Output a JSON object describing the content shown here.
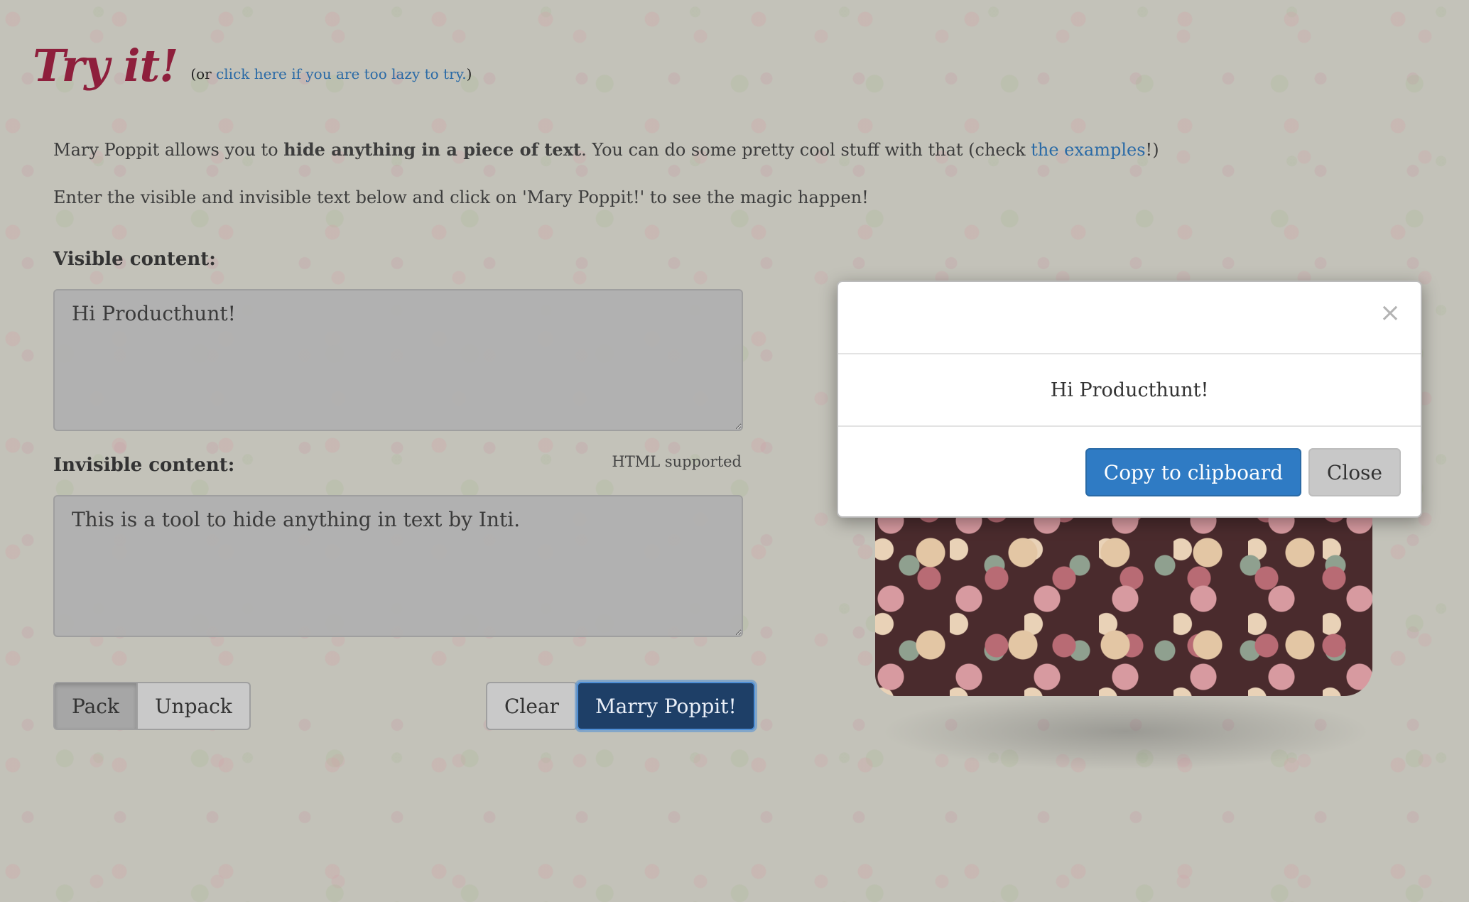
{
  "header": {
    "title": "Try it!",
    "lazy_prefix": "(or ",
    "lazy_link": "click here if you are too lazy to try.",
    "lazy_suffix": ")"
  },
  "intro": {
    "line1_a": "Mary Poppit allows you to ",
    "line1_bold": "hide anything in a piece of text",
    "line1_b": ". You can do some pretty cool stuff with that (check ",
    "line1_link": "the examples",
    "line1_c": "!)",
    "line2": "Enter the visible and invisible text below and click on 'Mary Poppit!' to see the magic happen!"
  },
  "form": {
    "visible_label": "Visible content:",
    "visible_value": "Hi Producthunt!",
    "invisible_label": "Invisible content:",
    "invisible_hint": "HTML supported",
    "invisible_value": "This is a tool to hide anything in text by Inti.",
    "pack_label": "Pack",
    "unpack_label": "Unpack",
    "clear_label": "Clear",
    "marry_label": "Marry Poppit!"
  },
  "modal": {
    "close_symbol": "×",
    "body_text": "Hi Producthunt!",
    "copy_label": "Copy to clipboard",
    "close_label": "Close"
  },
  "colors": {
    "title": "#8e1f3c",
    "link": "#2a6aa6",
    "primary_button": "#2f7bc4",
    "marry_button": "#1e3f67"
  }
}
